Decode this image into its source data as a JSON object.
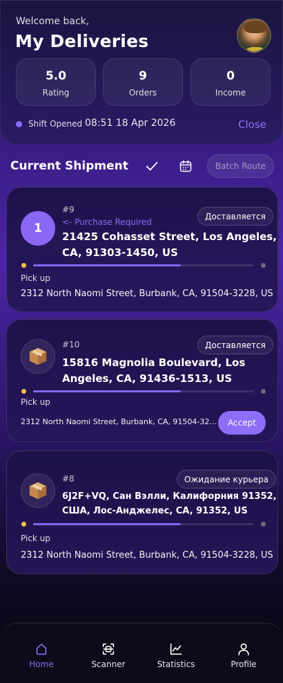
{
  "header": {
    "welcome": "Welcome back,",
    "title": "My Deliveries",
    "stats": [
      {
        "value": "5.0",
        "label": "Rating"
      },
      {
        "value": "9",
        "label": "Orders"
      },
      {
        "value": "0",
        "label": "Income"
      }
    ],
    "shift_label": "Shift Opened",
    "shift_time": "08:51 18 Apr 2026",
    "close_label": "Close"
  },
  "section": {
    "title": "Current Shipment",
    "batch_label": "Batch Route"
  },
  "shipments": [
    {
      "badge": "1",
      "order_id": "#9",
      "note": "<- Purchase Required",
      "status": "Доставляется",
      "address_line1": "21425 Cohasset Street, Los Angeles,",
      "address_line2": "CA, 91303-1450, US",
      "progress": 0.67,
      "pickup_label": "Pick up",
      "pickup_address": "2312 North Naomi Street, Burbank, CA, 91504-3228, US"
    },
    {
      "order_id": "#10",
      "status": "Доставляется",
      "address_line1": "15816 Magnolia Boulevard, Los",
      "address_line2": "Angeles, CA, 91436-1513, US",
      "progress": 0.67,
      "pickup_label": "Pick up",
      "pickup_address": "2312 North Naomi Street, Burbank, CA, 91504-32...",
      "accept_label": "Accept"
    },
    {
      "order_id": "#8",
      "status": "Ожидание курьера",
      "address_line1": "6J2F+VQ, Сан Вэлли, Калифорния 91352,",
      "address_line2": "США, Лос-Анджелес, CA, 91352, US",
      "progress": 0.67,
      "pickup_label": "Pick up",
      "pickup_address": "2312 North Naomi Street, Burbank, CA, 91504-3228, US"
    }
  ],
  "nav": {
    "items": [
      {
        "label": "Home",
        "icon": "home-icon",
        "active": true
      },
      {
        "label": "Scanner",
        "icon": "scanner-icon",
        "active": false
      },
      {
        "label": "Statistics",
        "icon": "statistics-icon",
        "active": false
      },
      {
        "label": "Profile",
        "icon": "profile-icon",
        "active": false
      }
    ]
  },
  "colors": {
    "accent": "#8d6ef7",
    "pickup_dot": "#f5c242",
    "background_top": "#1a0f3d",
    "background_mid": "#4a25a6"
  }
}
